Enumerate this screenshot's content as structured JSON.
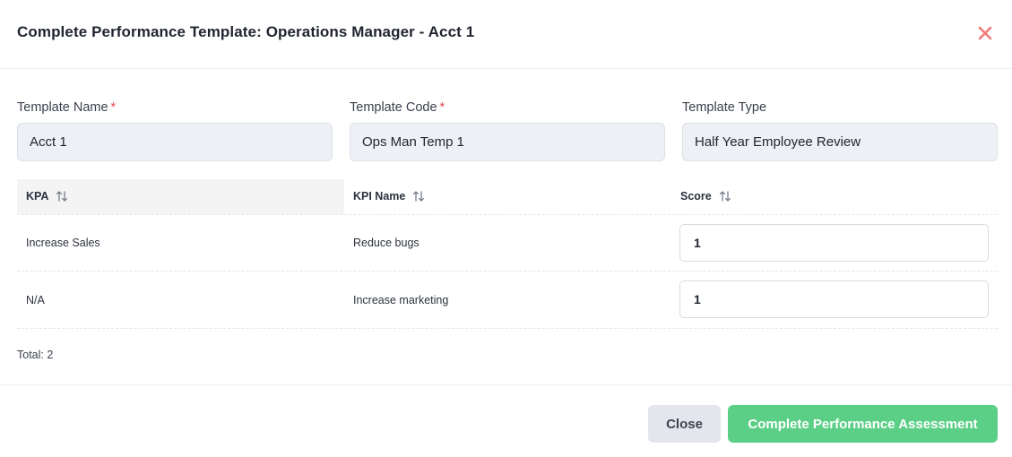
{
  "dialog": {
    "title": "Complete Performance Template: Operations Manager - Acct 1",
    "close_icon": "close-icon"
  },
  "fields": {
    "template_name": {
      "label": "Template Name",
      "required_mark": "*",
      "value": "Acct 1"
    },
    "template_code": {
      "label": "Template Code",
      "required_mark": "*",
      "value": "Ops Man Temp 1"
    },
    "template_type": {
      "label": "Template Type",
      "value": "Half Year Employee Review"
    }
  },
  "table": {
    "columns": [
      "KPA",
      "KPI Name",
      "Score"
    ],
    "sort_icon": "sort-arrows-icon",
    "rows": [
      {
        "kpa": "Increase Sales",
        "kpi_name": "Reduce bugs",
        "score": "1"
      },
      {
        "kpa": "N/A",
        "kpi_name": "Increase marketing",
        "score": "1"
      }
    ],
    "total": "Total: 2"
  },
  "buttons": {
    "close": "Close",
    "complete": "Complete Performance Assessment"
  },
  "colors": {
    "close_icon": "#f07a7a",
    "primary_button": "#5ccf87",
    "required": "#e5484d"
  }
}
